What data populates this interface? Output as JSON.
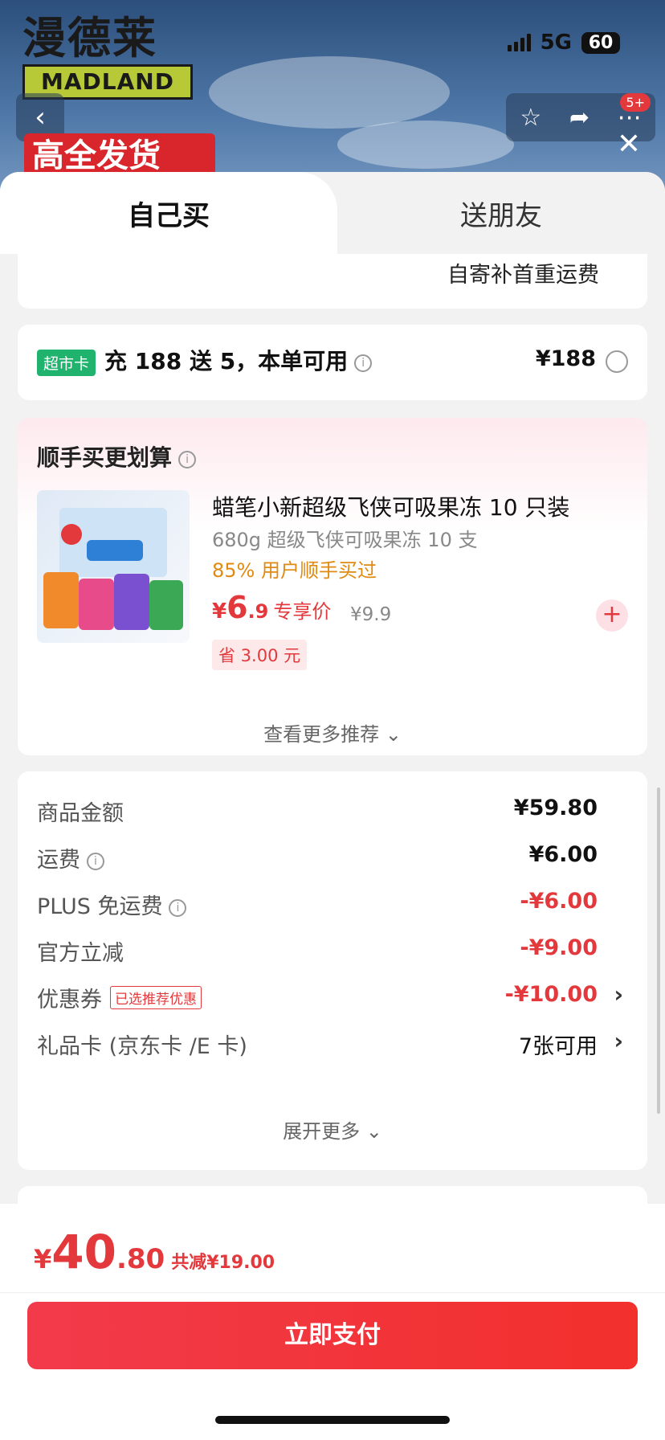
{
  "background": {
    "brand_cn": "漫德莱",
    "brand_en": "MADLAND",
    "network": "5G",
    "battery": "60",
    "cart_badge": "5+",
    "promo_text": "高全发货"
  },
  "tabs": [
    {
      "label": "自己买"
    },
    {
      "label": "送朋友"
    }
  ],
  "shipping_note": "自寄补首重运费",
  "supermarket_card": {
    "badge": "超市卡",
    "text": "充 188 送 5，本单可用",
    "price": "¥188"
  },
  "recommend": {
    "title": "顺手买更划算",
    "product": {
      "name": "蜡笔小新超级飞侠可吸果冻 10 只装",
      "spec": "680g 超级飞侠可吸果冻 10 支",
      "bought": "85% 用户顺手买过",
      "price_yen": "¥",
      "price_int": "6",
      "price_dec": ".9",
      "price_label": "专享价",
      "original_price": "¥9.9",
      "save_tag": "省 3.00 元"
    },
    "more_label": "查看更多推荐"
  },
  "summary": {
    "rows": [
      {
        "label": "商品金额",
        "value": "¥59.80"
      },
      {
        "label": "运费",
        "value": "¥6.00"
      },
      {
        "label": "PLUS 免运费",
        "value": "-¥6.00"
      },
      {
        "label": "官方立减",
        "value": "-¥9.00"
      },
      {
        "label": "优惠券",
        "tag": "已选推荐优惠",
        "value": "-¥10.00"
      },
      {
        "label": "礼品卡 (京东卡 /E 卡)",
        "value": "7张可用"
      }
    ],
    "expand_label": "展开更多"
  },
  "footer": {
    "yen": "¥",
    "total_int": "40",
    "total_dec": ".80",
    "reduced": "共减¥19.00",
    "pay_label": "立即支付"
  },
  "colors": {
    "accent_red": "#e4393c",
    "supermarket_green": "#1fb36e",
    "orange": "#e08a12"
  }
}
